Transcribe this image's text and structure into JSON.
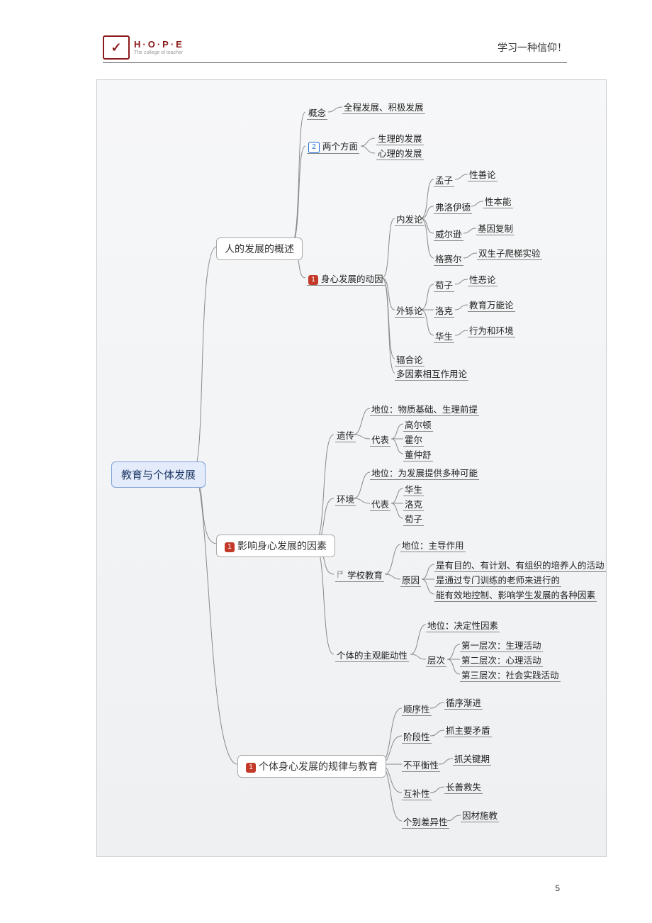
{
  "header": {
    "logo_letters": "H·O·P·E",
    "logo_sub": "The college of teacher",
    "slogan": "学习一种信仰！"
  },
  "page_number": "5",
  "root": "教育与个体发展",
  "b1": {
    "title": "人的发展的概述",
    "concept": {
      "label": "概念",
      "text": "全程发展、积极发展"
    },
    "two_aspects": {
      "label": "两个方面",
      "items": [
        "生理的发展",
        "心理的发展"
      ]
    },
    "drivers": {
      "label": "身心发展的动因",
      "inner": {
        "label": "内发论",
        "items": [
          {
            "who": "孟子",
            "what": "性善论"
          },
          {
            "who": "弗洛伊德",
            "what": "性本能"
          },
          {
            "who": "威尔逊",
            "what": "基因复制"
          },
          {
            "who": "格赛尔",
            "what": "双生子爬梯实验"
          }
        ]
      },
      "outer": {
        "label": "外铄论",
        "items": [
          {
            "who": "荀子",
            "what": "性恶论"
          },
          {
            "who": "洛克",
            "what": "教育万能论"
          },
          {
            "who": "华生",
            "what": "行为和环境"
          }
        ]
      },
      "convergent": "辐合论",
      "multi": "多因素相互作用论"
    }
  },
  "b2": {
    "title": "影响身心发展的因素",
    "heredity": {
      "label": "遗传",
      "position": "地位：物质基础、生理前提",
      "reps_label": "代表",
      "reps": [
        "高尔顿",
        "霍尔",
        "董仲舒"
      ]
    },
    "environment": {
      "label": "环境",
      "position": "地位：为发展提供多种可能",
      "reps_label": "代表",
      "reps": [
        "华生",
        "洛克",
        "荀子"
      ]
    },
    "schooling": {
      "label": "学校教育",
      "position": "地位：主导作用",
      "reason_label": "原因",
      "reasons": [
        "是有目的、有计划、有组织的培养人的活动",
        "是通过专门训练的老师来进行的",
        "能有效地控制、影响学生发展的各种因素"
      ]
    },
    "agency": {
      "label": "个体的主观能动性",
      "position": "地位：决定性因素",
      "levels_label": "层次",
      "levels": [
        "第一层次：生理活动",
        "第二层次：心理活动",
        "第三层次：社会实践活动"
      ]
    }
  },
  "b3": {
    "title": "个体身心发展的规律与教育",
    "items": [
      {
        "law": "顺序性",
        "edu": "循序渐进"
      },
      {
        "law": "阶段性",
        "edu": "抓主要矛盾"
      },
      {
        "law": "不平衡性",
        "edu": "抓关键期"
      },
      {
        "law": "互补性",
        "edu": "长善救失"
      },
      {
        "law": "个别差异性",
        "edu": "因材施教"
      }
    ]
  }
}
